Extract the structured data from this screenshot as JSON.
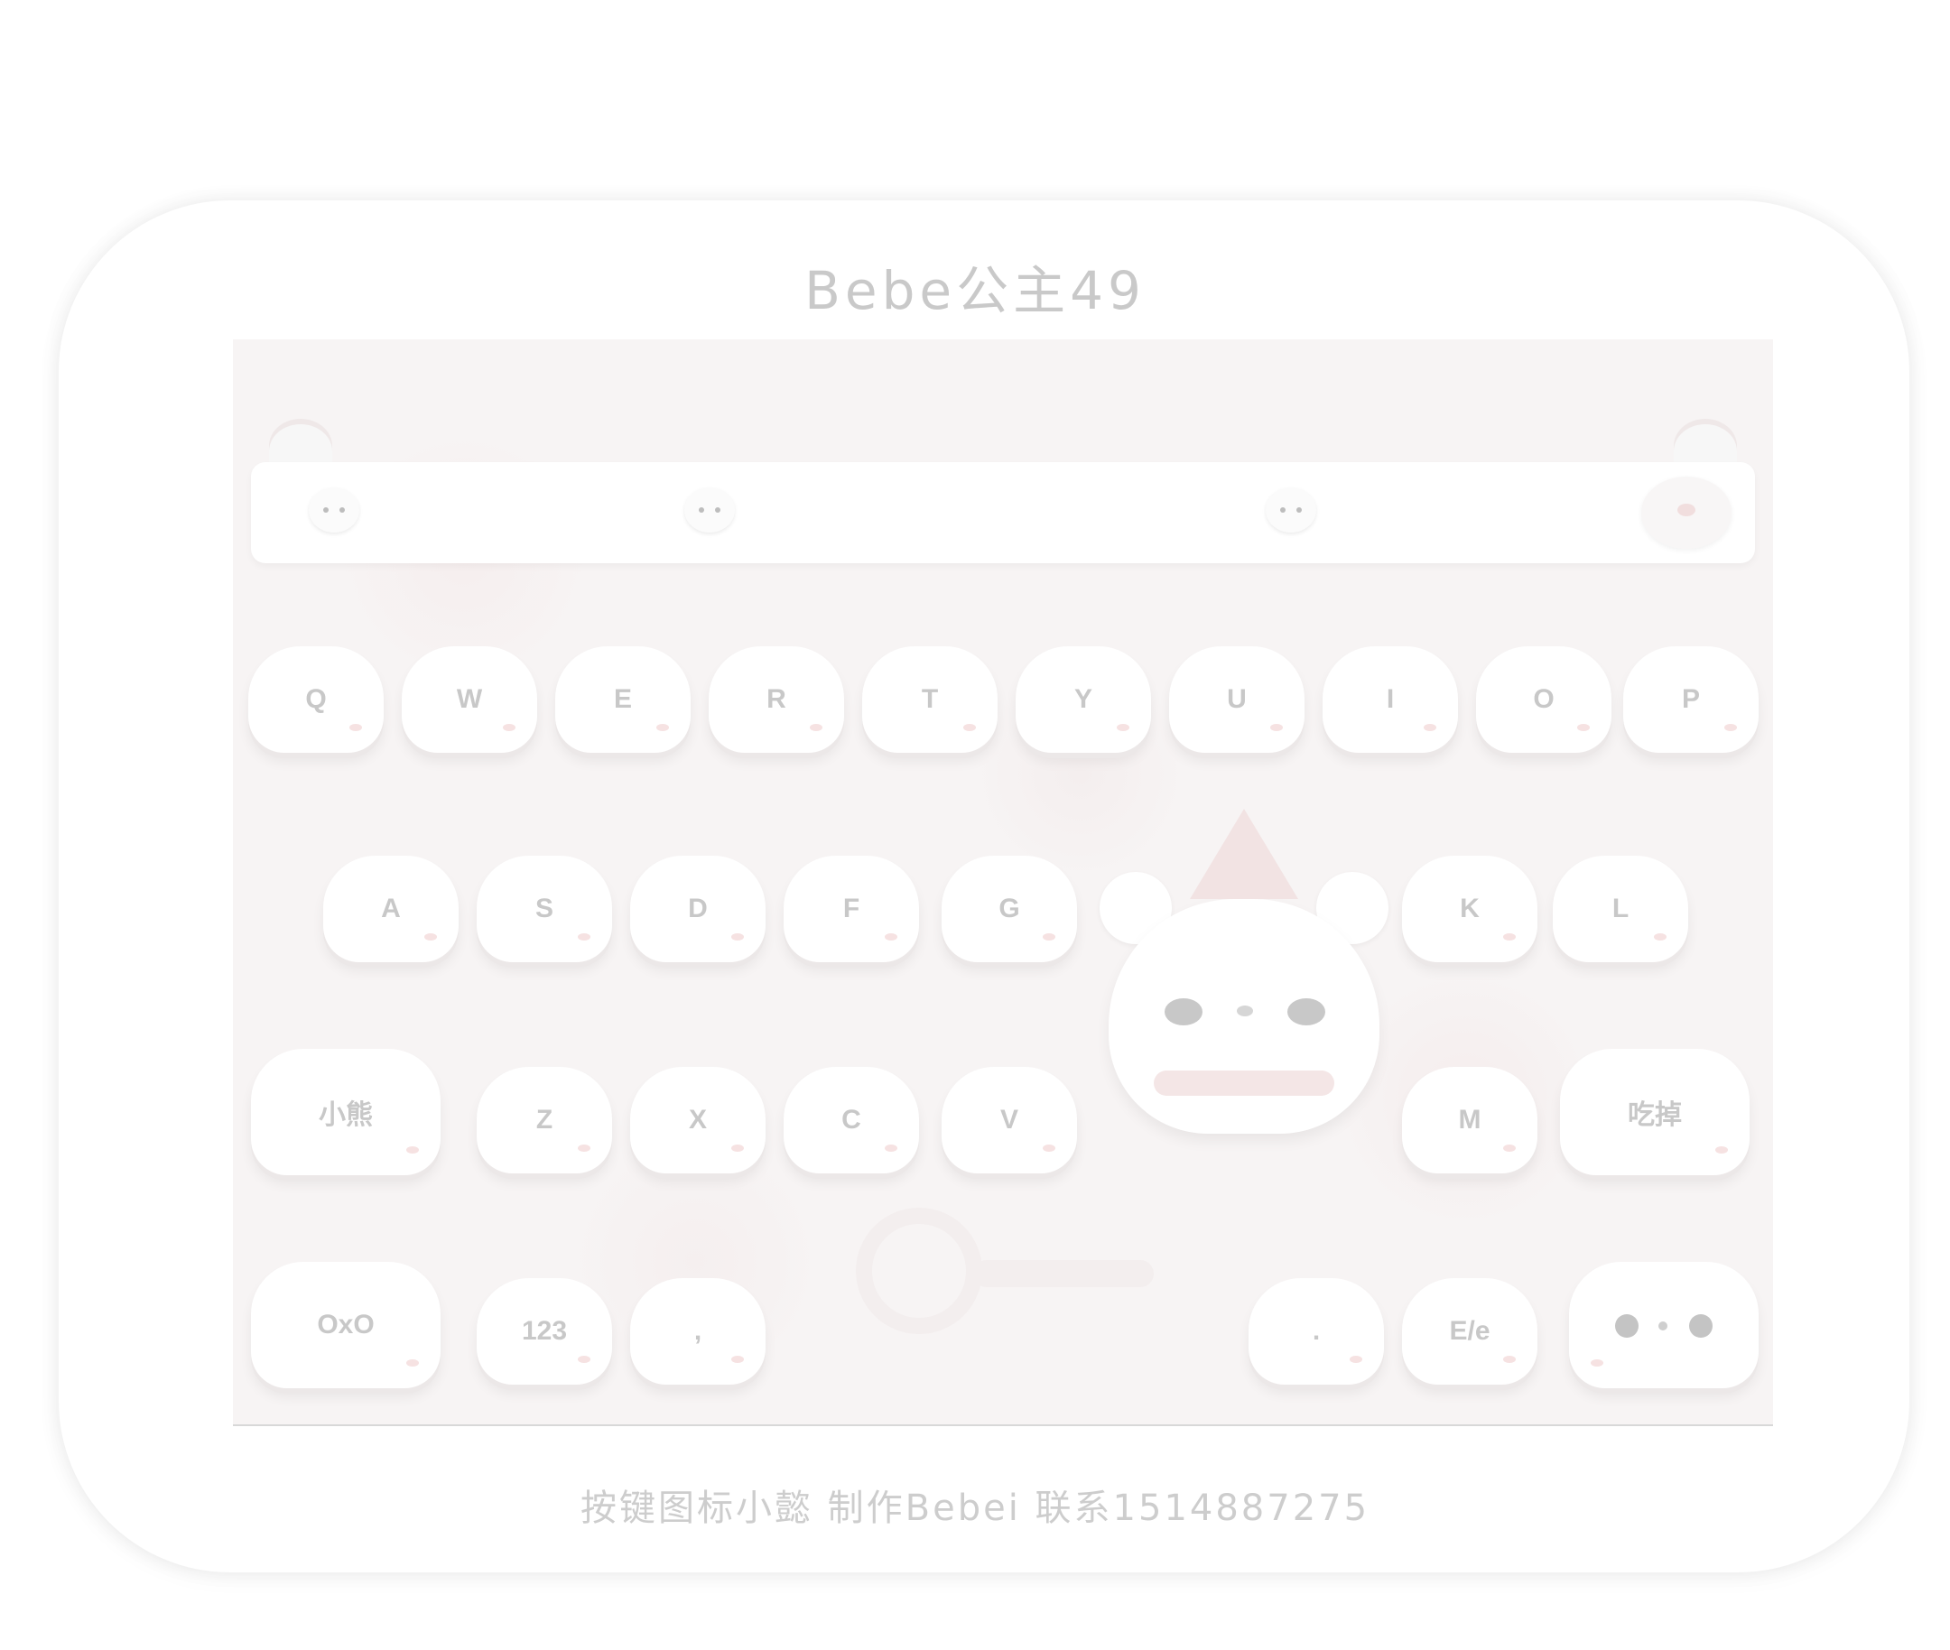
{
  "title": "Bebe公主49",
  "footer": "按键图标小懿 制作Bebei   联系1514887275",
  "keyboard": {
    "row1": [
      "Q",
      "W",
      "E",
      "R",
      "T",
      "Y",
      "U",
      "I",
      "O",
      "P"
    ],
    "row2": [
      "A",
      "S",
      "D",
      "F",
      "G",
      "K",
      "L"
    ],
    "row3": [
      "小熊",
      "Z",
      "X",
      "C",
      "V",
      "M",
      "吃掉"
    ],
    "row4": [
      "OxO",
      "123",
      ",",
      ".",
      "E/e"
    ]
  },
  "colors": {
    "text": "#c8c8c8",
    "background": "#f7f4f4",
    "accent_pink": "#f2e3e3"
  }
}
